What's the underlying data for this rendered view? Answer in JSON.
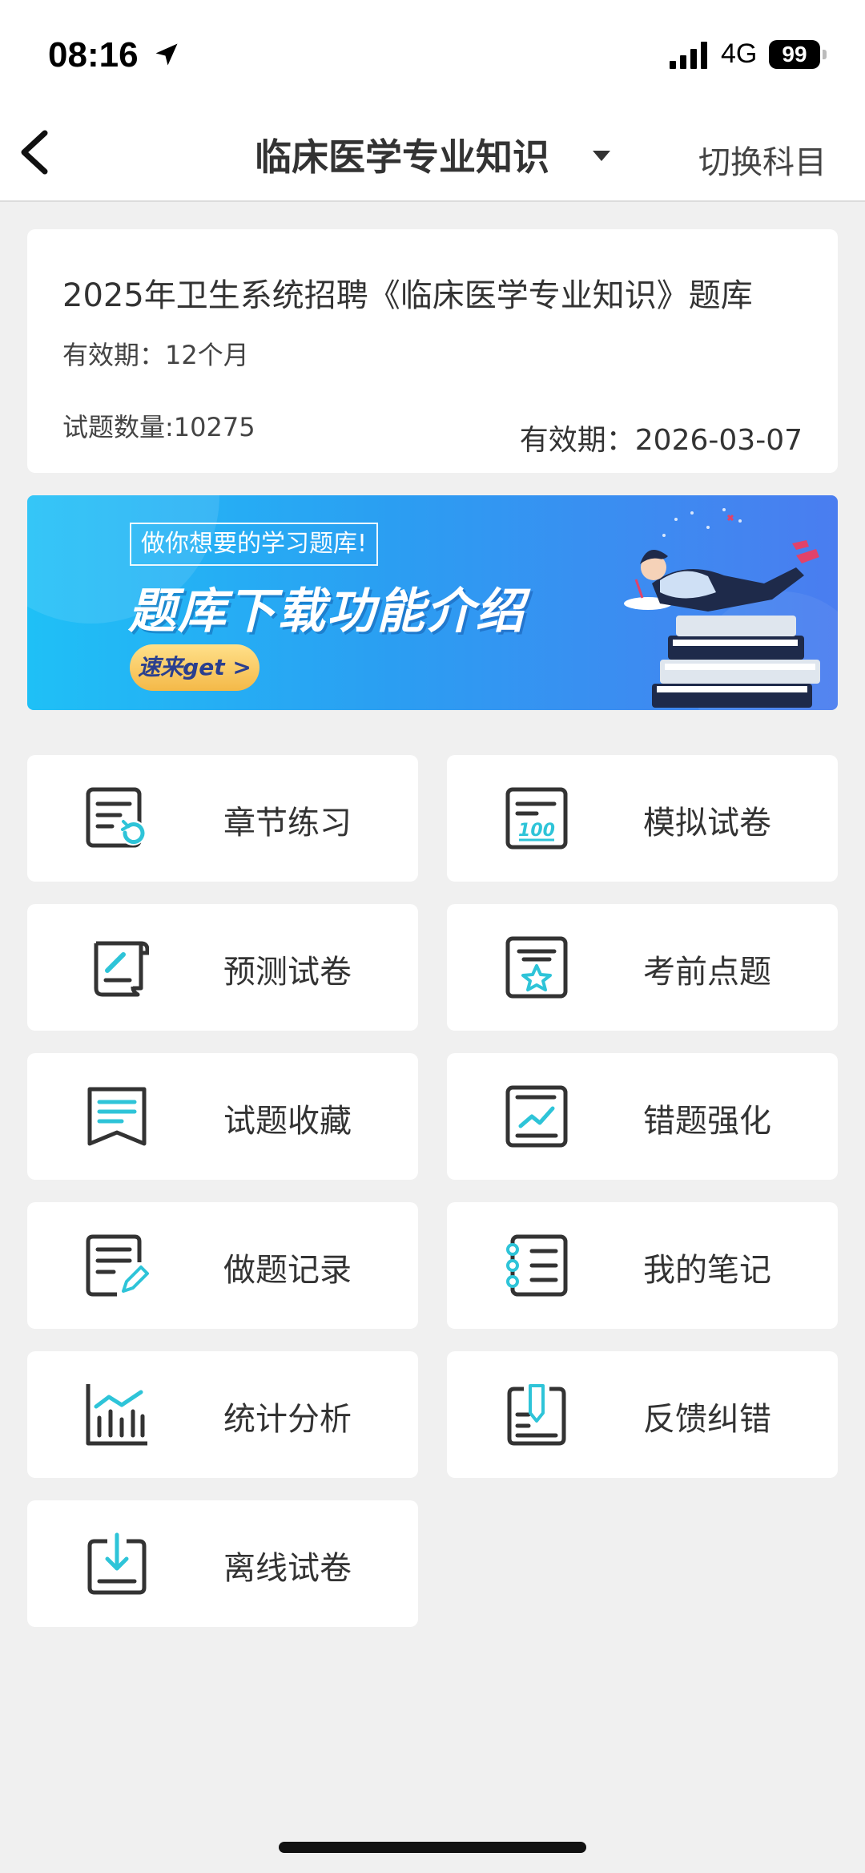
{
  "status_bar": {
    "time": "08:16",
    "network": "4G",
    "battery": "99"
  },
  "nav": {
    "title": "临床医学专业知识",
    "switch_label": "切换科目"
  },
  "bank": {
    "title": "2025年卫生系统招聘《临床医学专业知识》题库",
    "validity": "有效期：12个月",
    "question_count": "试题数量:10275",
    "expire": "有效期：2026-03-07"
  },
  "banner": {
    "subtitle": "做你想要的学习题库!",
    "title": "题库下载功能介绍",
    "cta": "速来get >"
  },
  "menu": [
    {
      "label": "章节练习",
      "icon": "chapter-practice-icon"
    },
    {
      "label": "模拟试卷",
      "icon": "mock-exam-icon"
    },
    {
      "label": "预测试卷",
      "icon": "forecast-exam-icon"
    },
    {
      "label": "考前点题",
      "icon": "pre-exam-tips-icon"
    },
    {
      "label": "试题收藏",
      "icon": "favorites-icon"
    },
    {
      "label": "错题强化",
      "icon": "wrong-questions-icon"
    },
    {
      "label": "做题记录",
      "icon": "practice-record-icon"
    },
    {
      "label": "我的笔记",
      "icon": "notes-icon"
    },
    {
      "label": "统计分析",
      "icon": "statistics-icon"
    },
    {
      "label": "反馈纠错",
      "icon": "feedback-icon"
    },
    {
      "label": "离线试卷",
      "icon": "offline-exam-icon"
    }
  ],
  "colors": {
    "accent": "#2ec4d8",
    "icon_dark": "#333333",
    "banner_blue": "#2b9ef2"
  }
}
